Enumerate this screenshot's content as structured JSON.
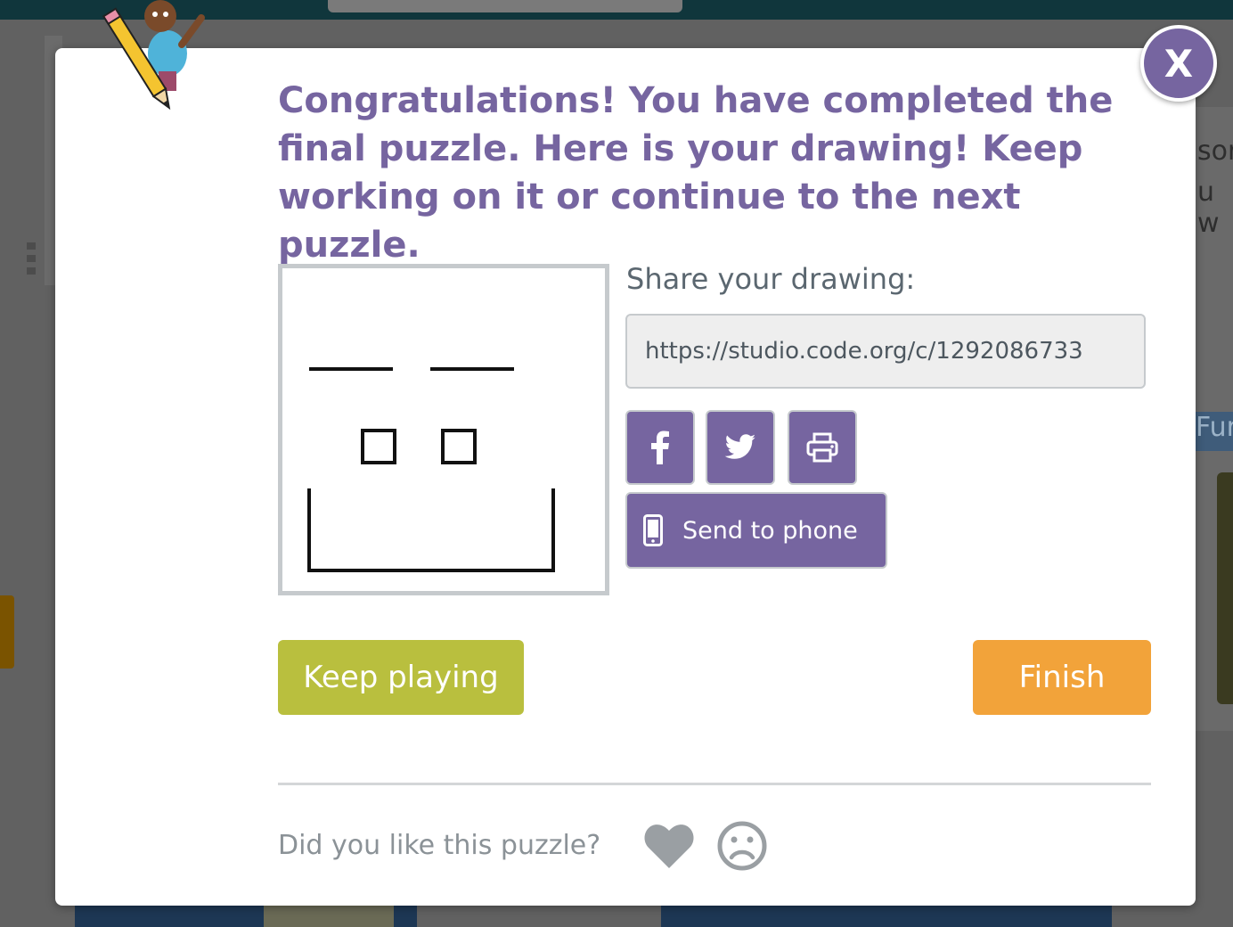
{
  "dialog": {
    "close_label": "X",
    "headline": "Congratulations! You have completed the final puzzle. Here is your drawing! Keep working on it or continue to the next puzzle.",
    "share": {
      "label": "Share your drawing:",
      "url": "https://studio.code.org/c/1292086733",
      "buttons": [
        "facebook-icon",
        "twitter-icon",
        "print-icon"
      ],
      "send_to_phone_label": "Send to phone"
    },
    "actions": {
      "keep_playing_label": "Keep playing",
      "finish_label": "Finish"
    },
    "feedback": {
      "question": "Did you like this puzzle?",
      "icons": [
        "heart-icon",
        "frown-icon"
      ]
    }
  },
  "background": {
    "right_text_1": "sor",
    "right_text_2": "u w",
    "right_tab": "Fur"
  },
  "colors": {
    "accent_purple": "#7665a0",
    "keep_green": "#b9bf3e",
    "finish_orange": "#f2a33a",
    "field_bg": "#eeeeee"
  }
}
